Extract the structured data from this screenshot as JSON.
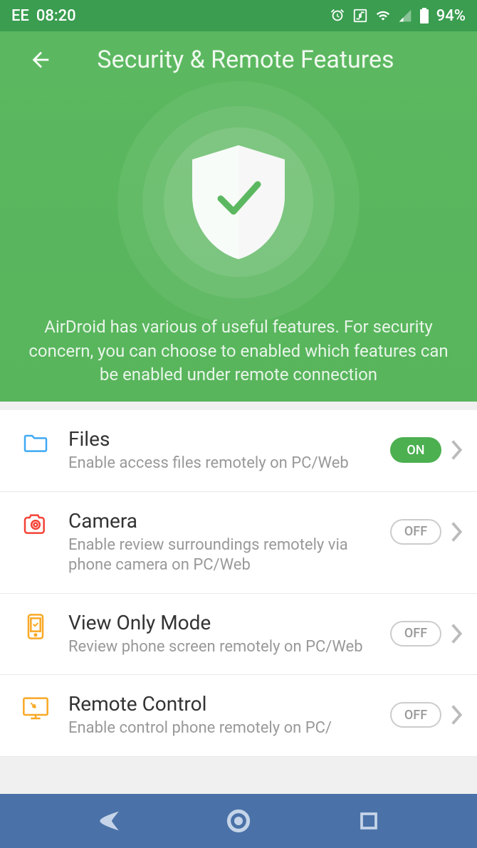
{
  "statusBar": {
    "carrier": "EE",
    "time": "08:20",
    "battery": "94%"
  },
  "header": {
    "title": "Security & Remote Features",
    "description": "AirDroid has various of useful features. For security concern, you can choose to enabled which features can be enabled under remote connection"
  },
  "features": [
    {
      "title": "Files",
      "subtitle": "Enable access files remotely on PC/Web",
      "toggle": "ON"
    },
    {
      "title": "Camera",
      "subtitle": "Enable review surroundings remotely via phone camera on PC/Web",
      "toggle": "OFF"
    },
    {
      "title": "View Only Mode",
      "subtitle": "Review phone screen remotely on PC/Web",
      "toggle": "OFF"
    },
    {
      "title": "Remote Control",
      "subtitle": "Enable control phone remotely on PC/",
      "toggle": "OFF"
    }
  ]
}
